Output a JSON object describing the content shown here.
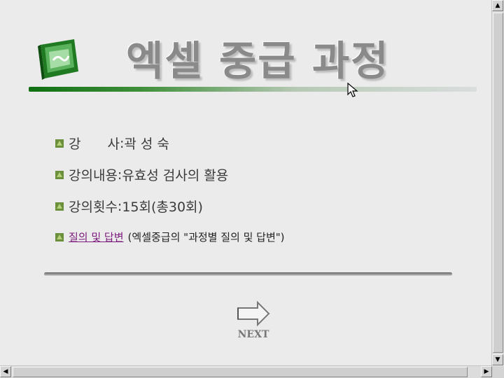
{
  "header": {
    "title": "엑셀 중급 과정"
  },
  "course_info": [
    {
      "label": "강　　사",
      "separator": " : ",
      "value": "곽 성 숙"
    },
    {
      "label": "강의내용",
      "separator": " : ",
      "value": "유효성 검사의 활용"
    },
    {
      "label": "강의횟수",
      "separator": " : ",
      "value": "15회(총30회)"
    }
  ],
  "qa": {
    "link_text": "질의 및 답변",
    "note": "(엑셀중급의 \"과정별 질의 및 답변\")"
  },
  "navigation": {
    "next_label": "NEXT"
  },
  "colors": {
    "link": "#7a1a7a",
    "title_rule_start": "#0f6f12",
    "title_text": "#8a8a8a"
  }
}
